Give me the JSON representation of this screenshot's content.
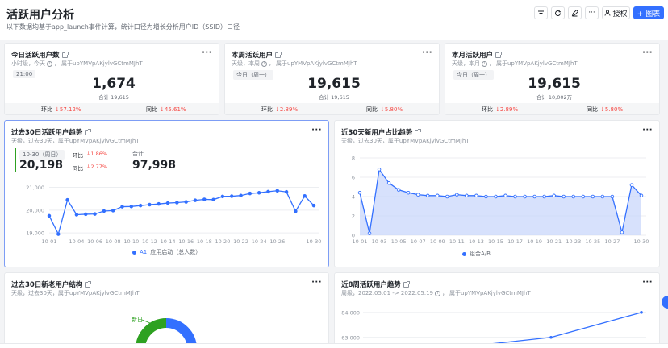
{
  "page": {
    "title": "活跃用户分析",
    "description": "以下数据均基于app_launch事件计算，统计口径为增长分析用户ID（SSID）口径"
  },
  "toolbar": {
    "filter_icon": "filter-icon",
    "refresh_icon": "refresh-icon",
    "edit_icon": "edit-icon",
    "more_label": "···",
    "authorize_label": "授权",
    "add_chart_label": "+ 图表"
  },
  "kpi_cards": [
    {
      "title": "今日活跃用户数",
      "subtitle_prefix": "小时级，今天",
      "subtitle_suffix": "属于upYMVpAKjylvGCtmMJhT",
      "period": "21:00",
      "value": "1,674",
      "total_label": "合计",
      "total_value": "19,615",
      "ring_label": "环比",
      "ring_value": "↓57.12%",
      "yoy_label": "同比",
      "yoy_value": "↓45.61%"
    },
    {
      "title": "本周活跃用户",
      "subtitle_prefix": "天级，本周",
      "subtitle_suffix": "属于upYMVpAKjylvGCtmMJhT",
      "period": "今日（周一）",
      "value": "19,615",
      "total_label": "合计",
      "total_value": "19,615",
      "ring_label": "环比",
      "ring_value": "↓2.89%",
      "yoy_label": "同比",
      "yoy_value": "↓5.80%"
    },
    {
      "title": "本月活跃用户",
      "subtitle_prefix": "天级，本月",
      "subtitle_suffix": "属于upYMVpAKjylvGCtmMJhT",
      "period": "今日（周一）",
      "value": "19,615",
      "total_label": "合计",
      "total_value": "10,002万",
      "ring_label": "环比",
      "ring_value": "↓2.89%",
      "yoy_label": "同比",
      "yoy_value": "↓5.80%"
    }
  ],
  "trend_card": {
    "title": "过去30日活跃用户趋势",
    "subtitle": "天级，过去30天，属于upYMVpAKjylvGCtmMJhT",
    "period": "10-30（周日）",
    "value": "20,198",
    "ring_label": "环比",
    "ring_value": "↓1.86%",
    "yoy_label": "同比",
    "yoy_value": "↓2.77%",
    "total_label": "合计",
    "total_value": "97,998",
    "legend_prefix": "A1",
    "legend_label": "应用启动（总人数）"
  },
  "ratio_card": {
    "title": "近30天新用户占比趋势",
    "subtitle": "天级，过去30天，属于upYMVpAKjylvGCtmMJhT",
    "legend_label": "组合A/B"
  },
  "newold_card": {
    "title": "过去30日新老用户结构",
    "subtitle": "天级，过去30天，属于upYMVpAKjylvGCtmMJhT",
    "donut_label": "新日"
  },
  "weekly_card": {
    "title": "近8周活跃用户趋势",
    "subtitle": "周级，2022.05.01 -> 2022.05.19",
    "subtitle_suffix": "属于upYMVpAKjylvGCtmMJhT",
    "y_ticks": [
      "84,000",
      "63,000"
    ]
  },
  "chart_data": [
    {
      "type": "line",
      "title": "过去30日活跃用户趋势",
      "x": [
        "10-01",
        "10-02",
        "10-03",
        "10-04",
        "10-05",
        "10-06",
        "10-07",
        "10-08",
        "10-09",
        "10-10",
        "10-11",
        "10-12",
        "10-13",
        "10-14",
        "10-15",
        "10-16",
        "10-17",
        "10-18",
        "10-19",
        "10-20",
        "10-21",
        "10-22",
        "10-23",
        "10-24",
        "10-25",
        "10-26",
        "10-27",
        "10-28",
        "10-29",
        "10-30"
      ],
      "x_tick_labels": [
        "10-01",
        "10-04",
        "10-06",
        "10-08",
        "10-10",
        "10-12",
        "10-14",
        "10-16",
        "10-18",
        "10-20",
        "10-22",
        "10-24",
        "10-26",
        "10-30"
      ],
      "series": [
        {
          "name": "应用启动（总人数）",
          "values": [
            19750,
            18950,
            20450,
            19800,
            19820,
            19830,
            19960,
            19980,
            20150,
            20160,
            20200,
            20240,
            20270,
            20310,
            20330,
            20360,
            20430,
            20470,
            20460,
            20600,
            20610,
            20640,
            20730,
            20760,
            20810,
            20850,
            20800,
            19950,
            20620,
            20200
          ]
        }
      ],
      "y_ticks": [
        "21,000",
        "20,000",
        "19,000"
      ],
      "ylim": [
        18900,
        21300
      ],
      "grid": true,
      "legend": "bottom"
    },
    {
      "type": "area",
      "title": "近30天新用户占比趋势",
      "x": [
        "10-01",
        "10-02",
        "10-03",
        "10-04",
        "10-05",
        "10-06",
        "10-07",
        "10-08",
        "10-09",
        "10-10",
        "10-11",
        "10-12",
        "10-13",
        "10-14",
        "10-15",
        "10-16",
        "10-17",
        "10-18",
        "10-19",
        "10-20",
        "10-21",
        "10-22",
        "10-23",
        "10-24",
        "10-25",
        "10-26",
        "10-27",
        "10-28",
        "10-29",
        "10-30"
      ],
      "x_tick_labels": [
        "10-01",
        "10-03",
        "10-05",
        "10-07",
        "10-09",
        "10-11",
        "10-13",
        "10-15",
        "10-17",
        "10-19",
        "10-21",
        "10-23",
        "10-25",
        "10-27",
        "10-30"
      ],
      "series": [
        {
          "name": "组合A/B",
          "values": [
            4.4,
            0.2,
            6.8,
            5.4,
            4.7,
            4.4,
            4.2,
            4.1,
            4.1,
            4.0,
            4.2,
            4.1,
            4.1,
            4.0,
            4.0,
            4.1,
            4.0,
            4.0,
            4.0,
            4.0,
            4.1,
            4.0,
            4.0,
            4.0,
            4.0,
            4.0,
            4.0,
            0.3,
            5.2,
            4.1
          ]
        }
      ],
      "y_ticks": [
        "8",
        "6",
        "4",
        "2",
        "0"
      ],
      "ylim": [
        0,
        8
      ],
      "grid": true,
      "legend": "bottom"
    },
    {
      "type": "line",
      "title": "近8周活跃用户趋势",
      "y_ticks": [
        "84,000",
        "63,000"
      ],
      "series": [
        {
          "values": [
            55000,
            63000,
            84000
          ]
        }
      ],
      "ylim": [
        52000,
        90000
      ]
    }
  ]
}
